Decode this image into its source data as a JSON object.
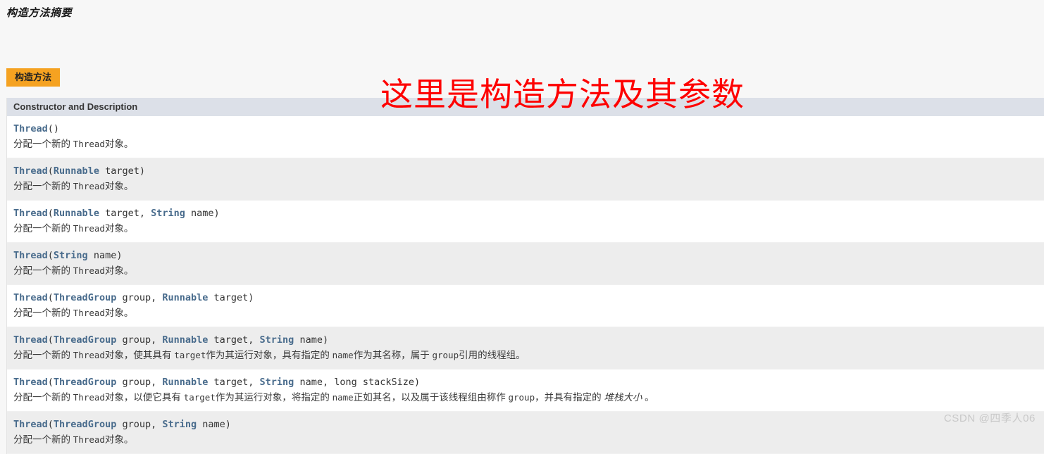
{
  "page": {
    "title": "构造方法摘要",
    "background_color": "#f7f7f7"
  },
  "tab": {
    "label": "构造方法",
    "color": "#f5a221"
  },
  "table": {
    "header": "Constructor and Description",
    "header_color": "#dce0e8",
    "link_color": "#486b8c",
    "rows": [
      {
        "signature_plain": "Thread()",
        "signature_parts": [
          {
            "text": "Thread",
            "kind": "type"
          },
          {
            "text": "()",
            "kind": "plain"
          }
        ],
        "description_plain": "分配一个新的 Thread对象。",
        "description_html": "分配一个新的 <code>Thread</code>对象。"
      },
      {
        "signature_plain": "Thread(Runnable target)",
        "signature_parts": [
          {
            "text": "Thread",
            "kind": "type"
          },
          {
            "text": "(",
            "kind": "plain"
          },
          {
            "text": "Runnable",
            "kind": "type"
          },
          {
            "text": " target)",
            "kind": "plain"
          }
        ],
        "description_plain": "分配一个新的 Thread对象。",
        "description_html": "分配一个新的 <code>Thread</code>对象。"
      },
      {
        "signature_plain": "Thread(Runnable target, String name)",
        "signature_parts": [
          {
            "text": "Thread",
            "kind": "type"
          },
          {
            "text": "(",
            "kind": "plain"
          },
          {
            "text": "Runnable",
            "kind": "type"
          },
          {
            "text": " target, ",
            "kind": "plain"
          },
          {
            "text": "String",
            "kind": "type"
          },
          {
            "text": " name)",
            "kind": "plain"
          }
        ],
        "description_plain": "分配一个新的 Thread对象。",
        "description_html": "分配一个新的 <code>Thread</code>对象。"
      },
      {
        "signature_plain": "Thread(String name)",
        "signature_parts": [
          {
            "text": "Thread",
            "kind": "type"
          },
          {
            "text": "(",
            "kind": "plain"
          },
          {
            "text": "String",
            "kind": "type"
          },
          {
            "text": " name)",
            "kind": "plain"
          }
        ],
        "description_plain": "分配一个新的 Thread对象。",
        "description_html": "分配一个新的 <code>Thread</code>对象。"
      },
      {
        "signature_plain": "Thread(ThreadGroup group, Runnable target)",
        "signature_parts": [
          {
            "text": "Thread",
            "kind": "type"
          },
          {
            "text": "(",
            "kind": "plain"
          },
          {
            "text": "ThreadGroup",
            "kind": "type"
          },
          {
            "text": " group, ",
            "kind": "plain"
          },
          {
            "text": "Runnable",
            "kind": "type"
          },
          {
            "text": " target)",
            "kind": "plain"
          }
        ],
        "description_plain": "分配一个新的 Thread对象。",
        "description_html": "分配一个新的 <code>Thread</code>对象。"
      },
      {
        "signature_plain": "Thread(ThreadGroup group, Runnable target, String name)",
        "signature_parts": [
          {
            "text": "Thread",
            "kind": "type"
          },
          {
            "text": "(",
            "kind": "plain"
          },
          {
            "text": "ThreadGroup",
            "kind": "type"
          },
          {
            "text": " group, ",
            "kind": "plain"
          },
          {
            "text": "Runnable",
            "kind": "type"
          },
          {
            "text": " target, ",
            "kind": "plain"
          },
          {
            "text": "String",
            "kind": "type"
          },
          {
            "text": " name)",
            "kind": "plain"
          }
        ],
        "description_plain": "分配一个新的 Thread对象，使其具有 target作为其运行对象，具有指定的 name作为其名称，属于 group引用的线程组。",
        "description_html": "分配一个新的 <code>Thread</code>对象，使其具有 <code>target</code>作为其运行对象，具有指定的 <code>name</code>作为其名称，属于 <code>group</code>引用的线程组。"
      },
      {
        "signature_plain": "Thread(ThreadGroup group, Runnable target, String name, long stackSize)",
        "signature_parts": [
          {
            "text": "Thread",
            "kind": "type"
          },
          {
            "text": "(",
            "kind": "plain"
          },
          {
            "text": "ThreadGroup",
            "kind": "type"
          },
          {
            "text": " group, ",
            "kind": "plain"
          },
          {
            "text": "Runnable",
            "kind": "type"
          },
          {
            "text": " target, ",
            "kind": "plain"
          },
          {
            "text": "String",
            "kind": "type"
          },
          {
            "text": " name, long stackSize)",
            "kind": "plain"
          }
        ],
        "description_plain": "分配一个新的 Thread对象，以便它具有 target作为其运行对象，将指定的 name正如其名，以及属于该线程组由称作 group，并具有指定的 堆栈大小 。",
        "description_html": "分配一个新的 <code>Thread</code>对象，以便它具有 <code>target</code>作为其运行对象，将指定的 <code>name</code>正如其名，以及属于该线程组由称作 <code>group</code>，并具有指定的 <span class=\"em\">堆栈大小</span> 。"
      },
      {
        "signature_plain": "Thread(ThreadGroup group, String name)",
        "signature_parts": [
          {
            "text": "Thread",
            "kind": "type"
          },
          {
            "text": "(",
            "kind": "plain"
          },
          {
            "text": "ThreadGroup",
            "kind": "type"
          },
          {
            "text": " group, ",
            "kind": "plain"
          },
          {
            "text": "String",
            "kind": "type"
          },
          {
            "text": " name)",
            "kind": "plain"
          }
        ],
        "description_plain": "分配一个新的 Thread对象。",
        "description_html": "分配一个新的 <code>Thread</code>对象。"
      }
    ]
  },
  "annotation": {
    "text": "这里是构造方法及其参数",
    "color": "#fe0000"
  },
  "watermark": {
    "text": "CSDN @四季人06"
  }
}
